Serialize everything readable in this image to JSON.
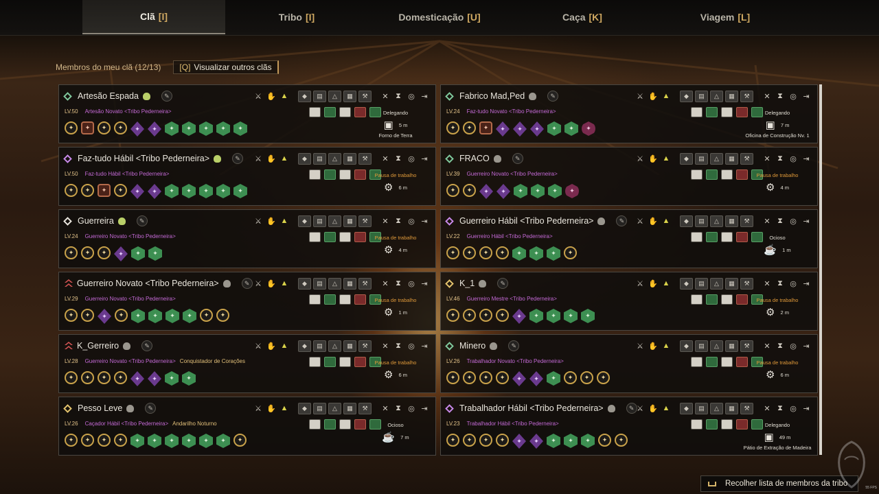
{
  "tabs": [
    {
      "label": "Clã",
      "key": "[I]",
      "active": true
    },
    {
      "label": "Tribo",
      "key": "[I]",
      "active": false
    },
    {
      "label": "Domesticação",
      "key": "[U]",
      "active": false
    },
    {
      "label": "Caça",
      "key": "[K]",
      "active": false
    },
    {
      "label": "Viagem",
      "key": "[L]",
      "active": false
    }
  ],
  "header": {
    "members_label": "Membros do meu clã (12/13)",
    "view_others_key": "[Q]",
    "view_others_label": "Visualizar outros clãs"
  },
  "members": [
    {
      "name": "Artesão Espada",
      "rank": "green",
      "level": "LV.50",
      "class": "Artesão Novato <Tribo Pederneira>",
      "title": "",
      "status": "Delegando",
      "time": "5 m",
      "location": "Forno de Terra",
      "status_icon": "workbench-icon"
    },
    {
      "name": "Fabrico Mad,Ped",
      "rank": "green",
      "level": "LV.24",
      "class": "Faz-tudo Novato <Tribo Pederneira>",
      "title": "",
      "status": "Delegando",
      "time": "7 m",
      "location": "Oficina de Construção Nv. 1",
      "status_icon": "workbench-icon"
    },
    {
      "name": "Faz-tudo Hábil <Tribo Pederneira>",
      "rank": "purple",
      "level": "LV.50",
      "class": "Faz-tudo Hábil <Tribo Pederneira>",
      "title": "",
      "status": "Pausa de trabalho",
      "time": "6 m",
      "location": "",
      "status_icon": "gear-icon"
    },
    {
      "name": "FRACO",
      "rank": "green",
      "level": "LV.39",
      "class": "Guerreiro Novato <Tribo Pederneira>",
      "title": "",
      "status": "Pausa de trabalho",
      "time": "4 m",
      "location": "",
      "status_icon": "gear-icon"
    },
    {
      "name": "Guerreira",
      "rank": "white",
      "level": "LV.24",
      "class": "Guerreiro Novato <Tribo Pederneira>",
      "title": "",
      "status": "Pausa de trabalho",
      "time": "4 m",
      "location": "",
      "status_icon": "gear-icon"
    },
    {
      "name": "Guerreiro Hábil <Tribo Pederneira>",
      "rank": "purple",
      "level": "LV.22",
      "class": "Guerreiro Hábil <Tribo Pederneira>",
      "title": "",
      "status": "Ocioso",
      "time": "1 m",
      "location": "",
      "status_icon": "coffee-icon"
    },
    {
      "name": "Guerreiro Novato <Tribo Pederneira>",
      "rank": "red",
      "level": "LV.29",
      "class": "Guerreiro Novato <Tribo Pederneira>",
      "title": "",
      "status": "Pausa de trabalho",
      "time": "1 m",
      "location": "",
      "status_icon": "gear-icon"
    },
    {
      "name": "K_1",
      "rank": "gold",
      "level": "LV.46",
      "class": "Guerreiro Mestre <Tribo Pederneira>",
      "title": "",
      "status": "Pausa de trabalho",
      "time": "2 m",
      "location": "",
      "status_icon": "gear-icon"
    },
    {
      "name": "K_Gerreiro",
      "rank": "red",
      "level": "LV.28",
      "class": "Guerreiro Novato <Tribo Pederneira>",
      "title": "Conquistador de Corações",
      "status": "Pausa de trabalho",
      "time": "6 m",
      "location": "",
      "status_icon": "gear-icon"
    },
    {
      "name": "Minero",
      "rank": "green",
      "level": "LV.26",
      "class": "Trabalhador Novato <Tribo Pederneira>",
      "title": "",
      "status": "Pausa de trabalho",
      "time": "6 m",
      "location": "",
      "status_icon": "gear-icon"
    },
    {
      "name": "Pesso Leve",
      "rank": "gold",
      "level": "LV.26",
      "class": "Caçador Hábil <Tribo Pederneira>",
      "title": "Andarilho Noturno",
      "status": "Ocioso",
      "time": "7 m",
      "location": "",
      "status_icon": "coffee-icon"
    },
    {
      "name": "Trabalhador Hábil <Tribo Pederneira>",
      "rank": "purple",
      "level": "LV.23",
      "class": "Trabalhador Hábil <Tribo Pederneira>",
      "title": "",
      "status": "Delegando",
      "time": "49 m",
      "location": "Pátio de Extração de Madeira",
      "status_icon": "workbench-icon"
    }
  ],
  "footer": {
    "collapse_label": "Recolher lista de membros da tribo",
    "fps": "55 FPS"
  }
}
